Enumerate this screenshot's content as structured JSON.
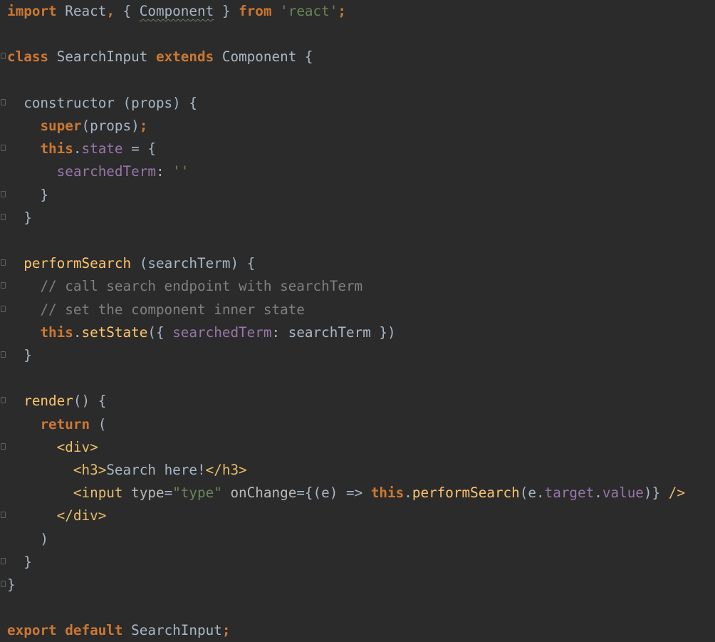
{
  "editor": {
    "language": "javascript-jsx",
    "theme_colors": {
      "background": "#2b2b2b",
      "keyword": "#cc7832",
      "string": "#6a8759",
      "comment": "#808080",
      "property": "#9876aa",
      "function": "#ffc66d",
      "tag": "#e8bf6a",
      "default": "#a9b7c6"
    },
    "lines": [
      [
        [
          "kw",
          "import"
        ],
        [
          "t",
          " React"
        ],
        [
          "kw",
          ","
        ],
        [
          "t",
          " { "
        ],
        [
          "typo",
          "Component"
        ],
        [
          "t",
          " } "
        ],
        [
          "kw",
          "from"
        ],
        [
          "t",
          " "
        ],
        [
          "str",
          "'react'"
        ],
        [
          "kw",
          ";"
        ]
      ],
      [],
      [
        [
          "kw",
          "class"
        ],
        [
          "t",
          " SearchInput "
        ],
        [
          "kw",
          "extends"
        ],
        [
          "t",
          " Component {"
        ]
      ],
      [],
      [
        [
          "t",
          "  constructor (props) {"
        ]
      ],
      [
        [
          "t",
          "    "
        ],
        [
          "kw",
          "super"
        ],
        [
          "t",
          "(props)"
        ],
        [
          "kw",
          ";"
        ]
      ],
      [
        [
          "t",
          "    "
        ],
        [
          "kw",
          "this"
        ],
        [
          "t",
          "."
        ],
        [
          "prop",
          "state"
        ],
        [
          "t",
          " = {"
        ]
      ],
      [
        [
          "t",
          "      "
        ],
        [
          "prop",
          "searchedTerm"
        ],
        [
          "t",
          ": "
        ],
        [
          "str",
          "''"
        ]
      ],
      [
        [
          "t",
          "    }"
        ]
      ],
      [
        [
          "t",
          "  }"
        ]
      ],
      [],
      [
        [
          "t",
          "  "
        ],
        [
          "fn",
          "performSearch"
        ],
        [
          "t",
          " (searchTerm) {"
        ]
      ],
      [
        [
          "t",
          "    "
        ],
        [
          "cmt",
          "// call search endpoint with searchTerm"
        ]
      ],
      [
        [
          "t",
          "    "
        ],
        [
          "cmt",
          "// set the component inner state"
        ]
      ],
      [
        [
          "t",
          "    "
        ],
        [
          "kw",
          "this"
        ],
        [
          "t",
          "."
        ],
        [
          "fn",
          "setState"
        ],
        [
          "t",
          "({ "
        ],
        [
          "prop",
          "searchedTerm"
        ],
        [
          "t",
          ": searchTerm })"
        ]
      ],
      [
        [
          "t",
          "  }"
        ]
      ],
      [],
      [
        [
          "t",
          "  "
        ],
        [
          "fn",
          "render"
        ],
        [
          "t",
          "() {"
        ]
      ],
      [
        [
          "t",
          "    "
        ],
        [
          "kw",
          "return"
        ],
        [
          "t",
          " ("
        ]
      ],
      [
        [
          "t",
          "      "
        ],
        [
          "tag",
          "<div>"
        ]
      ],
      [
        [
          "t",
          "        "
        ],
        [
          "tag",
          "<h3>"
        ],
        [
          "t",
          "Search here!"
        ],
        [
          "tag",
          "</h3>"
        ]
      ],
      [
        [
          "t",
          "        "
        ],
        [
          "tag",
          "<input"
        ],
        [
          "t",
          " "
        ],
        [
          "attr",
          "type"
        ],
        [
          "t",
          "="
        ],
        [
          "str",
          "\"type\""
        ],
        [
          "t",
          " "
        ],
        [
          "attr",
          "onChange"
        ],
        [
          "t",
          "={(e) => "
        ],
        [
          "kw",
          "this"
        ],
        [
          "t",
          "."
        ],
        [
          "fn",
          "performSearch"
        ],
        [
          "t",
          "(e."
        ],
        [
          "prop",
          "target"
        ],
        [
          "t",
          "."
        ],
        [
          "prop",
          "value"
        ],
        [
          "t",
          ")} "
        ],
        [
          "tag",
          "/>"
        ]
      ],
      [
        [
          "t",
          "      "
        ],
        [
          "tag",
          "</div>"
        ]
      ],
      [
        [
          "t",
          "    )"
        ]
      ],
      [
        [
          "t",
          "  }"
        ]
      ],
      [
        [
          "t",
          "}"
        ]
      ],
      [],
      [
        [
          "kw",
          "export"
        ],
        [
          "t",
          " "
        ],
        [
          "kw",
          "default"
        ],
        [
          "t",
          " SearchInput"
        ],
        [
          "kw",
          ";"
        ]
      ]
    ],
    "fold_markers": [
      2,
      4,
      6,
      8,
      9,
      11,
      12,
      13,
      15,
      17,
      19,
      22,
      24,
      25
    ]
  }
}
